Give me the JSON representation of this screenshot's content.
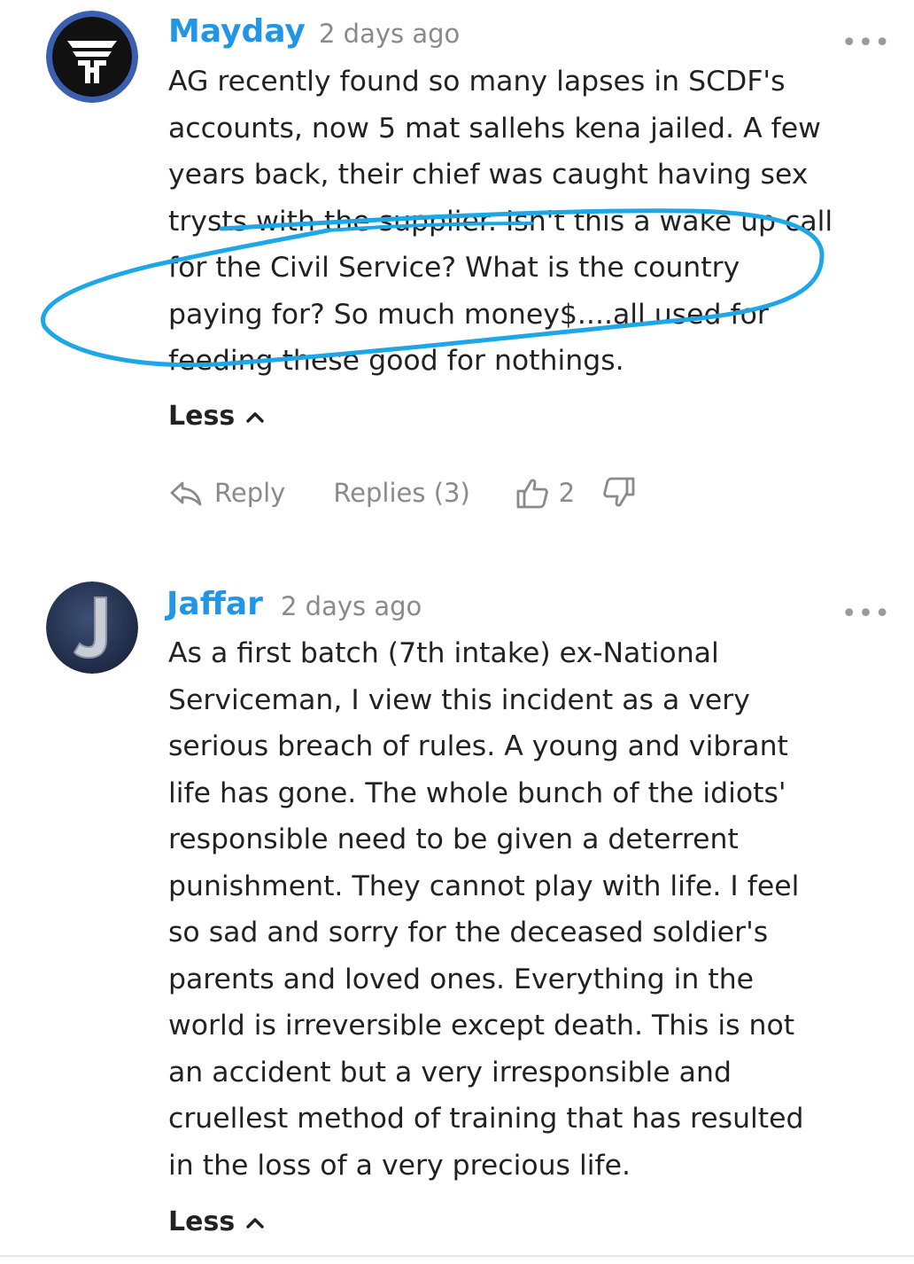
{
  "comments": [
    {
      "author": "Mayday",
      "time": "2 days ago",
      "more": "•••",
      "avatar": "mayday-logo-avatar",
      "body": "AG recently found so many lapses in SCDF's\naccounts, now 5 mat sallehs kena jailed. A few\nyears back, their chief was caught having sex\ntrysts with the supplier. Isn't this a wake up call\nfor the Civil Service? What is the country\npaying for? So much money$....all used for\nfeeding these good for nothings.",
      "less_label": "Less",
      "reply_label": "Reply",
      "replies_label": "Replies (3)",
      "likes": "2"
    },
    {
      "author": "Jaffar",
      "time": "2 days ago",
      "more": "•••",
      "avatar": "letter-j-avatar",
      "body": "As a first batch (7th intake) ex-National\nServiceman, I view this incident as a very\nserious breach of rules. A young and vibrant\nlife has gone. The whole bunch of the idiots'\nresponsible need to be given a deterrent\npunishment. They cannot play with life. I feel\nso sad and sorry for the deceased soldier's\nparents and loved ones. Everything in the\nworld is irreversible except death. This is not\nan accident but a very irresponsible and\ncruellest method of training that has resulted\nin the loss of a very precious life.",
      "less_label": "Less"
    }
  ],
  "colors": {
    "author": "#2196e6",
    "annotation": "#1ea7e6",
    "meta": "#8a8a8a"
  }
}
